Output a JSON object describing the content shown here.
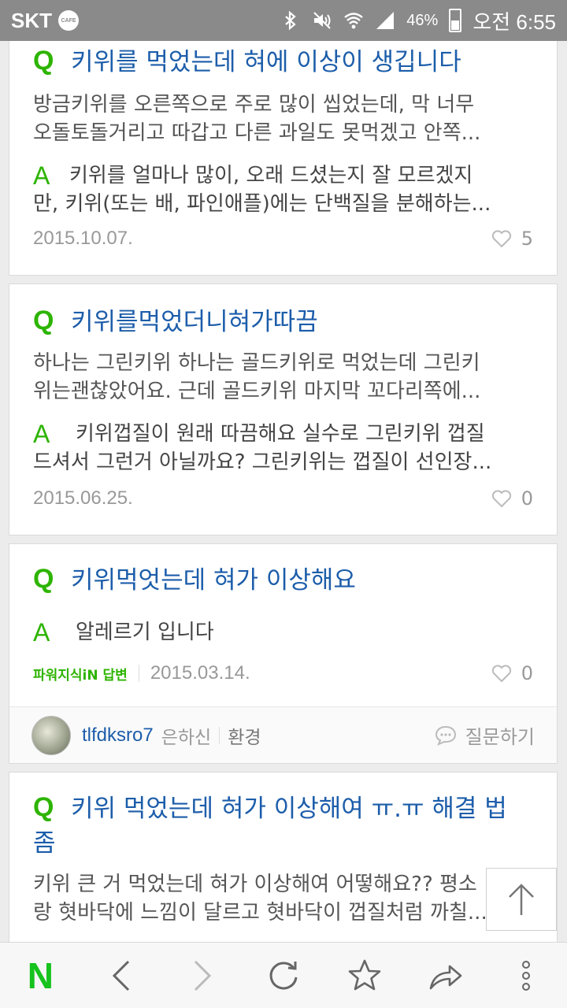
{
  "status_bar": {
    "carrier": "SKT",
    "cafe_badge": "CAFE",
    "battery": "46%",
    "time": "오전 6:55"
  },
  "cards": [
    {
      "q_mark": "Q",
      "title": "키위를 먹었는데 혀에 이상이 생깁니다",
      "body_line1": "방금키위를 오른쪽으로 주로 많이 씹었는데, 막 너무",
      "body_line2": "오돌토돌거리고 따갑고 다른 과일도 못먹겠고 안쪽...",
      "a_mark": "A",
      "answer_line1": "키위를 얼마나 많이, 오래 드셨는지 잘 모르겠지",
      "answer_line2": "만, 키위(또는 배, 파인애플)에는 단백질을 분해하는...",
      "date": "2015.10.07.",
      "likes": "5"
    },
    {
      "q_mark": "Q",
      "title": "키위를먹었더니혀가따끔",
      "body_line1": "하나는 그린키위 하나는 골드키위로 먹었는데 그린키",
      "body_line2": "위는괜찮았어요. 근데 골드키위 마지막 꼬다리쪽에...",
      "a_mark": "A",
      "answer_line1": "키위껍질이 원래 따끔해요 실수로 그린키위 껍질",
      "answer_line2": "드셔서 그런거 아닐까요? 그린키위는 껍질이 선인장...",
      "date": "2015.06.25.",
      "likes": "0"
    },
    {
      "q_mark": "Q",
      "title": "키위먹엇는데 혀가 이상해요",
      "a_mark": "A",
      "answer_line1": "알레르기 입니다",
      "power_label": "파워지식iN 답변",
      "date": "2015.03.14.",
      "likes": "0",
      "user": {
        "name": "tlfdksro7",
        "grade": "은하신",
        "field": "환경",
        "ask_label": "질문하기"
      }
    },
    {
      "q_mark": "Q",
      "title_line1": "키위 먹었는데 혀가 이상해여 ㅠ.ㅠ 해결 법",
      "title_line2": "좀",
      "body_line1": "키위 큰 거 먹었는데 혀가 이상해여 어떻해요?? 평소",
      "body_line2": "랑 혓바닥에 느낌이 달르고 혓바닥이 껍질처럼 까칠..."
    }
  ],
  "bottom_bar": {
    "logo": "N",
    "icons": [
      "naver-home-icon",
      "back-icon",
      "forward-icon",
      "refresh-icon",
      "bookmark-star-icon",
      "share-icon",
      "more-icon"
    ]
  },
  "colors": {
    "accent_green": "#2db400",
    "title_blue": "#1c5daa",
    "statusbar_gray": "#8a8a8a"
  }
}
